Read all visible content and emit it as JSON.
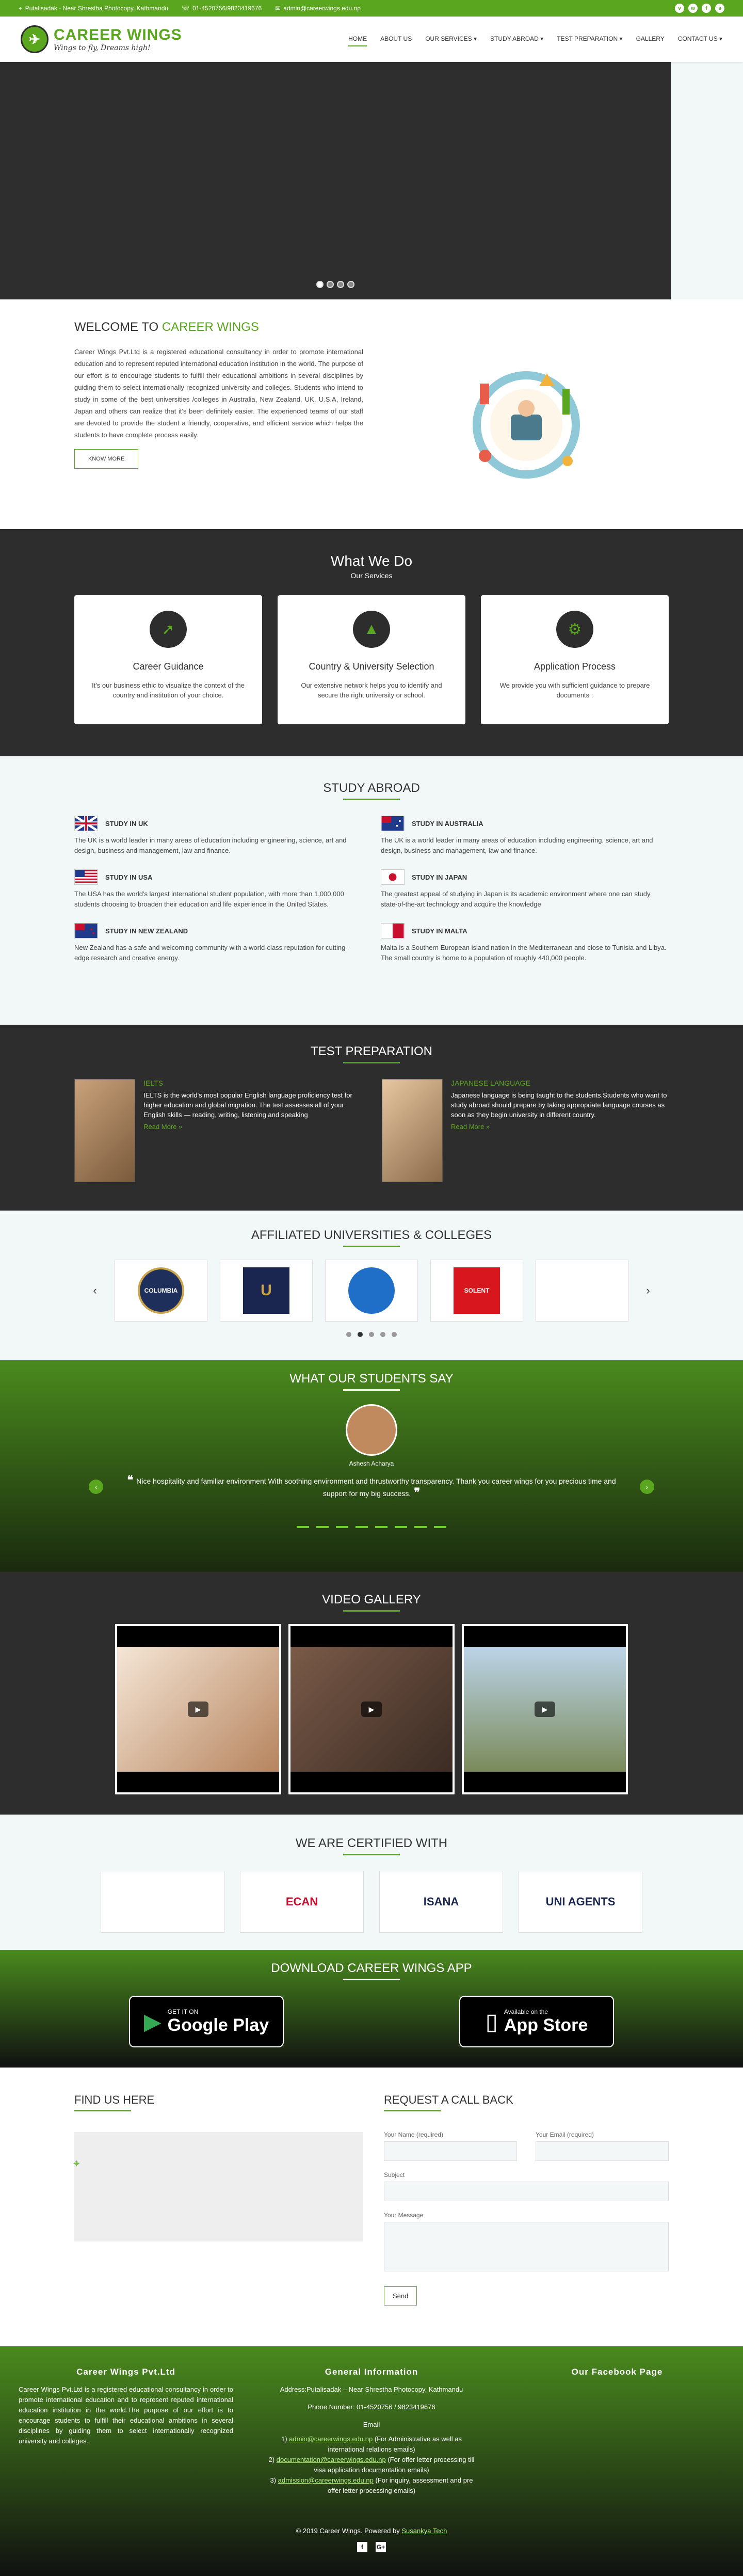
{
  "topbar": {
    "address": "Putalisadak - Near Shrestha Photocopy, Kathmandu",
    "phone": "01-4520756/9823419676",
    "email": "admin@careerwings.edu.np"
  },
  "brand": {
    "name": "CAREER WINGS",
    "tagline": "Wings to fly, Dreams high!"
  },
  "nav": [
    "HOME",
    "ABOUT US",
    "OUR SERVICES ▾",
    "STUDY ABROAD ▾",
    "TEST PREPARATION ▾",
    "GALLERY",
    "CONTACT US ▾"
  ],
  "welcome": {
    "title_prefix": "WELCOME TO ",
    "title_brand": "CAREER WINGS",
    "body": "Career Wings Pvt.Ltd is a registered educational consultancy in order to promote international education and to represent reputed international education institution in the world. The purpose of our effort is to encourage students to fulfill their educational ambitions in several disciplines by guiding them to select internationally recognized university and colleges. Students who intend to study in some of the best universities /colleges in Australia, New Zealand, UK, U.S.A, Ireland, Japan and others can realize that it's been definitely easier. The experienced teams of our staff are devoted to provide the student a friendly, cooperative, and efficient service which helps the students to have complete process easily.",
    "button": "KNOW MORE"
  },
  "whatwedo": {
    "title": "What We Do",
    "subtitle": "Our Services",
    "cards": [
      {
        "title": "Career Guidance",
        "text": "It's our business ethic to visualize the context of the country and institution of your choice."
      },
      {
        "title": "Country & University Selection",
        "text": "Our extensive network helps you to identify and secure the right university or school."
      },
      {
        "title": "Application Process",
        "text": "We provide you with sufficient guidance to prepare documents ."
      }
    ]
  },
  "study": {
    "title": "STUDY ABROAD",
    "items": [
      {
        "title": "STUDY IN UK",
        "text": "The UK is a world leader in many areas of education including engineering, science, art and design, business and management, law and finance."
      },
      {
        "title": "STUDY IN AUSTRALIA",
        "text": "The UK is a world leader in many areas of education including engineering, science, art and design, business and management, law and finance."
      },
      {
        "title": "STUDY IN USA",
        "text": "The USA has the world's largest international student population, with more than 1,000,000 students choosing to broaden their education and life experience in the United States."
      },
      {
        "title": "STUDY IN JAPAN",
        "text": "The greatest appeal of studying in Japan is its academic environment where one can study state-of-the-art technology and acquire the knowledge"
      },
      {
        "title": "STUDY IN NEW ZEALAND",
        "text": "New Zealand has a safe and welcoming community with a world-class reputation for cutting-edge research and creative energy."
      },
      {
        "title": "STUDY IN MALTA",
        "text": "Malta is a Southern European island nation in the Mediterranean and close to Tunisia and Libya. The small country is home to a population of roughly 440,000 people."
      }
    ]
  },
  "testprep": {
    "title": "TEST PREPARATION",
    "items": [
      {
        "title": "IELTS",
        "text": "IELTS is the world's most popular English language proficiency test for higher education and global migration. The test assesses all of your English skills — reading, writing, listening and speaking",
        "more": "Read More »"
      },
      {
        "title": "JAPANESE LANGUAGE",
        "text": "Japanese language is being taught to the students.Students who want to study abroad should prepare by taking appropriate language courses as soon as they begin university in different country.",
        "more": "Read More »"
      }
    ]
  },
  "affil": {
    "title": "AFFILIATED UNIVERSITIES & COLLEGES",
    "logos": [
      "COLUMBIA",
      "U",
      "",
      "SOLENT",
      ""
    ]
  },
  "testi": {
    "title": "WHAT OUR STUDENTS SAY",
    "name": "Ashesh Acharya",
    "quote": "Nice hospitality and familiar environment With soothing environment and thrustworthy transparency. Thank you career wings for you precious time and support for my big success."
  },
  "video": {
    "title": "VIDEO GALLERY"
  },
  "certified": {
    "title": "WE ARE CERTIFIED WITH",
    "logos": [
      "",
      "ECAN",
      "ISANA",
      "UNI AGENTS"
    ]
  },
  "app": {
    "title": "DOWNLOAD CAREER WINGS APP",
    "google_small": "GET IT ON",
    "google_big": "Google Play",
    "apple_small": "Available on the",
    "apple_big": "App Store"
  },
  "findus": {
    "title": "FIND US HERE"
  },
  "callback": {
    "title": "REQUEST A CALL BACK",
    "name_label": "Your Name (required)",
    "email_label": "Your Email (required)",
    "subject_label": "Subject",
    "message_label": "Your Message",
    "send": "Send"
  },
  "footer": {
    "col1_title": "Career Wings Pvt.Ltd",
    "col1_text": "Career Wings Pvt.Ltd is a registered educational consultancy in order to promote international education and to represent reputed international education institution in the world.The purpose of our effort is to encourage students to fulfill their educational ambitions in several disciplines by guiding them to select internationally recognized university and colleges.",
    "col2_title": "General Information",
    "address": "Address:Putalisadak – Near Shrestha Photocopy, Kathmandu",
    "phone": "Phone Number: 01-4520756 / 9823419676",
    "email_heading": "Email",
    "email1": "admin@careerwings.edu.np",
    "email1_note": "(For Administrative as well as international relations emails)",
    "email2": "documentation@careerwings.edu.np",
    "email2_note": "(For offer letter processing till visa application documentation emails)",
    "email3": "admission@careerwings.edu.np",
    "email3_note": "(For inquiry, assessment and pre offer letter processing emails)",
    "col3_title": "Our Facebook Page",
    "copyright": "© 2019 Career Wings. Powered by ",
    "powered": "Susankya Tech"
  },
  "colors": {
    "accent": "#5aa61f",
    "dark": "#2d2d2d",
    "light_bg": "#f2f8f8"
  }
}
